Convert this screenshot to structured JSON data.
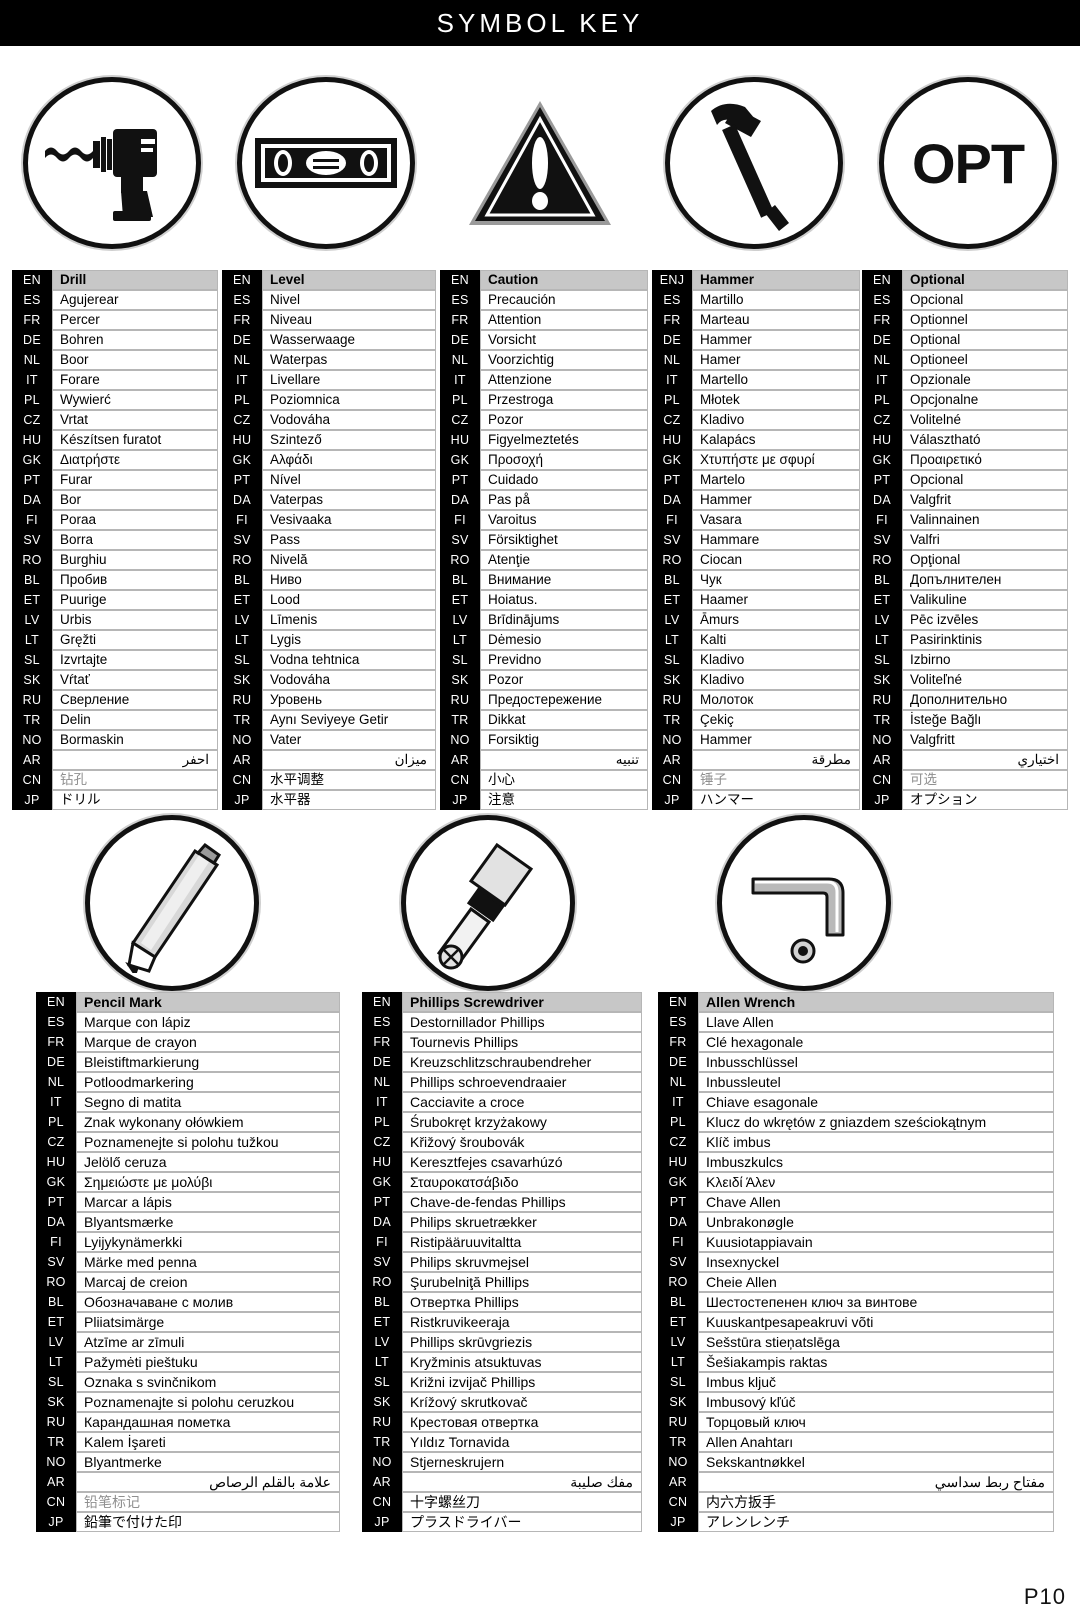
{
  "header": {
    "title": "SYMBOL KEY"
  },
  "footer": {
    "page_number": "P10"
  },
  "language_codes": [
    "EN",
    "ES",
    "FR",
    "DE",
    "NL",
    "IT",
    "PL",
    "CZ",
    "HU",
    "GK",
    "PT",
    "DA",
    "FI",
    "SV",
    "RO",
    "BL",
    "ET",
    "LV",
    "LT",
    "SL",
    "SK",
    "RU",
    "TR",
    "NO",
    "AR",
    "CN",
    "JP"
  ],
  "top_symbols": [
    {
      "icon": "drill-icon",
      "label": "Drill"
    },
    {
      "icon": "level-icon",
      "label": "Level"
    },
    {
      "icon": "caution-triangle-icon",
      "label": "Caution"
    },
    {
      "icon": "hammer-icon",
      "label": "Hammer"
    },
    {
      "icon": "opt-text-icon",
      "label": "OPT"
    }
  ],
  "bottom_symbols": [
    {
      "icon": "pencil-icon",
      "label": "Pencil Mark"
    },
    {
      "icon": "phillips-screwdriver-icon",
      "label": "Phillips Screwdriver"
    },
    {
      "icon": "allen-wrench-icon",
      "label": "Allen Wrench"
    }
  ],
  "top_tables": [
    {
      "name": "drill",
      "header_code": "EN",
      "header_value": "Drill",
      "rows": [
        {
          "code": "ES",
          "value": "Agujerear"
        },
        {
          "code": "FR",
          "value": "Percer"
        },
        {
          "code": "DE",
          "value": "Bohren"
        },
        {
          "code": "NL",
          "value": "Boor"
        },
        {
          "code": "IT",
          "value": "Forare"
        },
        {
          "code": "PL",
          "value": "Wywierć"
        },
        {
          "code": "CZ",
          "value": "Vrtat"
        },
        {
          "code": "HU",
          "value": "Készítsen furatot"
        },
        {
          "code": "GK",
          "value": "Διατρήστε"
        },
        {
          "code": "PT",
          "value": "Furar"
        },
        {
          "code": "DA",
          "value": "Bor"
        },
        {
          "code": "FI",
          "value": "Poraa"
        },
        {
          "code": "SV",
          "value": "Borra"
        },
        {
          "code": "RO",
          "value": "Burghiu"
        },
        {
          "code": "BL",
          "value": "Пробив"
        },
        {
          "code": "ET",
          "value": "Puurige"
        },
        {
          "code": "LV",
          "value": "Urbis"
        },
        {
          "code": "LT",
          "value": "Gręžti"
        },
        {
          "code": "SL",
          "value": "Izvrtajte"
        },
        {
          "code": "SK",
          "value": "Vŕtať"
        },
        {
          "code": "RU",
          "value": "Сверление"
        },
        {
          "code": "TR",
          "value": "Delin"
        },
        {
          "code": "NO",
          "value": "Bormaskin"
        },
        {
          "code": "AR",
          "value": "احفر"
        },
        {
          "code": "CN",
          "value": "钻孔"
        },
        {
          "code": "JP",
          "value": "ドリル"
        }
      ]
    },
    {
      "name": "level",
      "header_code": "EN",
      "header_value": "Level",
      "rows": [
        {
          "code": "ES",
          "value": "Nivel"
        },
        {
          "code": "FR",
          "value": "Niveau"
        },
        {
          "code": "DE",
          "value": "Wasserwaage"
        },
        {
          "code": "NL",
          "value": "Waterpas"
        },
        {
          "code": "IT",
          "value": "Livellare"
        },
        {
          "code": "PL",
          "value": "Poziomnica"
        },
        {
          "code": "CZ",
          "value": "Vodováha"
        },
        {
          "code": "HU",
          "value": "Szintező"
        },
        {
          "code": "GK",
          "value": "Αλφάδι"
        },
        {
          "code": "PT",
          "value": "Nível"
        },
        {
          "code": "DA",
          "value": "Vaterpas"
        },
        {
          "code": "FI",
          "value": "Vesivaaka"
        },
        {
          "code": "SV",
          "value": "Pass"
        },
        {
          "code": "RO",
          "value": "Nivelă"
        },
        {
          "code": "BL",
          "value": "Ниво"
        },
        {
          "code": "ET",
          "value": "Lood"
        },
        {
          "code": "LV",
          "value": "Līmenis"
        },
        {
          "code": "LT",
          "value": "Lygis"
        },
        {
          "code": "SL",
          "value": "Vodna tehtnica"
        },
        {
          "code": "SK",
          "value": "Vodováha"
        },
        {
          "code": "RU",
          "value": "Уровень"
        },
        {
          "code": "TR",
          "value": "Aynı Seviyeye Getir"
        },
        {
          "code": "NO",
          "value": "Vater"
        },
        {
          "code": "AR",
          "value": "ميزان"
        },
        {
          "code": "CN",
          "value": "水平调整"
        },
        {
          "code": "JP",
          "value": "水平器"
        }
      ]
    },
    {
      "name": "caution",
      "header_code": "EN",
      "header_value": "Caution",
      "rows": [
        {
          "code": "ES",
          "value": "Precaución"
        },
        {
          "code": "FR",
          "value": "Attention"
        },
        {
          "code": "DE",
          "value": "Vorsicht"
        },
        {
          "code": "NL",
          "value": "Voorzichtig"
        },
        {
          "code": "IT",
          "value": "Attenzione"
        },
        {
          "code": "PL",
          "value": "Przestroga"
        },
        {
          "code": "CZ",
          "value": "Pozor"
        },
        {
          "code": "HU",
          "value": "Figyelmeztetés"
        },
        {
          "code": "GK",
          "value": "Προσοχή"
        },
        {
          "code": "PT",
          "value": "Cuidado"
        },
        {
          "code": "DA",
          "value": "Pas på"
        },
        {
          "code": "FI",
          "value": "Varoitus"
        },
        {
          "code": "SV",
          "value": "Försiktighet"
        },
        {
          "code": "RO",
          "value": "Atenţie"
        },
        {
          "code": "BL",
          "value": "Внимание"
        },
        {
          "code": "ET",
          "value": "Hoiatus."
        },
        {
          "code": "LV",
          "value": "Brīdinājums"
        },
        {
          "code": "LT",
          "value": "Dėmesio"
        },
        {
          "code": "SL",
          "value": "Previdno"
        },
        {
          "code": "SK",
          "value": "Pozor"
        },
        {
          "code": "RU",
          "value": "Предостережение"
        },
        {
          "code": "TR",
          "value": "Dikkat"
        },
        {
          "code": "NO",
          "value": "Forsiktig"
        },
        {
          "code": "AR",
          "value": "تنبيه"
        },
        {
          "code": "CN",
          "value": "小心"
        },
        {
          "code": "JP",
          "value": "注意"
        }
      ]
    },
    {
      "name": "hammer",
      "header_code": "ENJ",
      "header_value": "Hammer",
      "rows": [
        {
          "code": "ES",
          "value": "Martillo"
        },
        {
          "code": "FR",
          "value": "Marteau"
        },
        {
          "code": "DE",
          "value": "Hammer"
        },
        {
          "code": "NL",
          "value": "Hamer"
        },
        {
          "code": "IT",
          "value": "Martello"
        },
        {
          "code": "PL",
          "value": "Młotek"
        },
        {
          "code": "CZ",
          "value": "Kladivo"
        },
        {
          "code": "HU",
          "value": "Kalapács"
        },
        {
          "code": "GK",
          "value": "Χτυπήστε με σφυρί"
        },
        {
          "code": "PT",
          "value": "Martelo"
        },
        {
          "code": "DA",
          "value": "Hammer"
        },
        {
          "code": "FI",
          "value": "Vasara"
        },
        {
          "code": "SV",
          "value": "Hammare"
        },
        {
          "code": "RO",
          "value": "Ciocan"
        },
        {
          "code": "BL",
          "value": "Чук"
        },
        {
          "code": "ET",
          "value": "Haamer"
        },
        {
          "code": "LV",
          "value": "Āmurs"
        },
        {
          "code": "LT",
          "value": "Kalti"
        },
        {
          "code": "SL",
          "value": "Kladivo"
        },
        {
          "code": "SK",
          "value": "Kladivo"
        },
        {
          "code": "RU",
          "value": "Молоток"
        },
        {
          "code": "TR",
          "value": "Çekiç"
        },
        {
          "code": "NO",
          "value": "Hammer"
        },
        {
          "code": "AR",
          "value": "مطرقة"
        },
        {
          "code": "CN",
          "value": "锤子"
        },
        {
          "code": "JP",
          "value": "ハンマー"
        }
      ]
    },
    {
      "name": "optional",
      "header_code": "EN",
      "header_value": "Optional",
      "rows": [
        {
          "code": "ES",
          "value": "Opcional"
        },
        {
          "code": "FR",
          "value": "Optionnel"
        },
        {
          "code": "DE",
          "value": "Optional"
        },
        {
          "code": "NL",
          "value": "Optioneel"
        },
        {
          "code": "IT",
          "value": "Opzionale"
        },
        {
          "code": "PL",
          "value": "Opcjonalne"
        },
        {
          "code": "CZ",
          "value": "Volitelné"
        },
        {
          "code": "HU",
          "value": "Választható"
        },
        {
          "code": "GK",
          "value": "Προαιρετικό"
        },
        {
          "code": "PT",
          "value": "Opcional"
        },
        {
          "code": "DA",
          "value": "Valgfrit"
        },
        {
          "code": "FI",
          "value": "Valinnainen"
        },
        {
          "code": "SV",
          "value": "Valfri"
        },
        {
          "code": "RO",
          "value": "Opţional"
        },
        {
          "code": "BL",
          "value": "Допълнителен"
        },
        {
          "code": "ET",
          "value": "Valikuline"
        },
        {
          "code": "LV",
          "value": "Pēc izvēles"
        },
        {
          "code": "LT",
          "value": "Pasirinktinis"
        },
        {
          "code": "SL",
          "value": "Izbirno"
        },
        {
          "code": "SK",
          "value": "Voliteľné"
        },
        {
          "code": "RU",
          "value": "Дополнительно"
        },
        {
          "code": "TR",
          "value": "İsteğe Bağlı"
        },
        {
          "code": "NO",
          "value": "Valgfritt"
        },
        {
          "code": "AR",
          "value": "اختياري"
        },
        {
          "code": "CN",
          "value": "可选"
        },
        {
          "code": "JP",
          "value": "オプション"
        }
      ]
    }
  ],
  "bottom_tables": [
    {
      "name": "pencil-mark",
      "header_code": "EN",
      "header_value": "Pencil Mark",
      "rows": [
        {
          "code": "ES",
          "value": "Marque con lápiz"
        },
        {
          "code": "FR",
          "value": "Marque de crayon"
        },
        {
          "code": "DE",
          "value": "Bleistiftmarkierung"
        },
        {
          "code": "NL",
          "value": "Potloodmarkering"
        },
        {
          "code": "IT",
          "value": "Segno di matita"
        },
        {
          "code": "PL",
          "value": "Znak wykonany ołówkiem"
        },
        {
          "code": "CZ",
          "value": "Poznamenejte si polohu tužkou"
        },
        {
          "code": "HU",
          "value": "Jelölő ceruza"
        },
        {
          "code": "GK",
          "value": "Σημειώστε με μολύβι"
        },
        {
          "code": "PT",
          "value": "Marcar a lápis"
        },
        {
          "code": "DA",
          "value": "Blyantsmærke"
        },
        {
          "code": "FI",
          "value": "Lyijykynämerkki"
        },
        {
          "code": "SV",
          "value": "Märke med penna"
        },
        {
          "code": "RO",
          "value": "Marcaj de creion"
        },
        {
          "code": "BL",
          "value": "Обозначаване с молив"
        },
        {
          "code": "ET",
          "value": "Pliiatsimärge"
        },
        {
          "code": "LV",
          "value": "Atzīme ar zīmuli"
        },
        {
          "code": "LT",
          "value": "Pažymėti pieštuku"
        },
        {
          "code": "SL",
          "value": "Oznaka s svinčnikom"
        },
        {
          "code": "SK",
          "value": "Poznamenajte si polohu ceruzkou"
        },
        {
          "code": "RU",
          "value": "Карандашная пометка"
        },
        {
          "code": "TR",
          "value": "Kalem İşareti"
        },
        {
          "code": "NO",
          "value": "Blyantmerke"
        },
        {
          "code": "AR",
          "value": "علامة بالقلم الرصاص"
        },
        {
          "code": "CN",
          "value": "铅笔标记"
        },
        {
          "code": "JP",
          "value": "鉛筆で付けた印"
        }
      ]
    },
    {
      "name": "phillips-screwdriver",
      "header_code": "EN",
      "header_value": "Phillips Screwdriver",
      "rows": [
        {
          "code": "ES",
          "value": "Destornillador Phillips"
        },
        {
          "code": "FR",
          "value": "Tournevis Phillips"
        },
        {
          "code": "DE",
          "value": "Kreuzschlitzschraubendreher"
        },
        {
          "code": "NL",
          "value": "Phillips schroevendraaier"
        },
        {
          "code": "IT",
          "value": "Cacciavite a croce"
        },
        {
          "code": "PL",
          "value": "Śrubokręt krzyżakowy"
        },
        {
          "code": "CZ",
          "value": "Křižový šroubovák"
        },
        {
          "code": "HU",
          "value": "Keresztfejes csavarhúzó"
        },
        {
          "code": "GK",
          "value": "Σταυροκατσάβιδο"
        },
        {
          "code": "PT",
          "value": "Chave-de-fendas Phillips"
        },
        {
          "code": "DA",
          "value": "Philips skruetrækker"
        },
        {
          "code": "FI",
          "value": "Ristipääruuvitaltta"
        },
        {
          "code": "SV",
          "value": "Philips skruvmejsel"
        },
        {
          "code": "RO",
          "value": "Şurubelniţă Phillips"
        },
        {
          "code": "BL",
          "value": "Отвертка Phillips"
        },
        {
          "code": "ET",
          "value": "Ristkruvikeeraja"
        },
        {
          "code": "LV",
          "value": "Phillips skrūvgriezis"
        },
        {
          "code": "LT",
          "value": "Kryžminis atsuktuvas"
        },
        {
          "code": "SL",
          "value": "Križni izvijač Phillips"
        },
        {
          "code": "SK",
          "value": "Krížový skrutkovač"
        },
        {
          "code": "RU",
          "value": "Крестовая отвертка"
        },
        {
          "code": "TR",
          "value": "Yıldız Tornavida"
        },
        {
          "code": "NO",
          "value": "Stjerneskrujern"
        },
        {
          "code": "AR",
          "value": "مفك صليبة"
        },
        {
          "code": "CN",
          "value": "十字螺丝刀"
        },
        {
          "code": "JP",
          "value": "プラスドライバー"
        }
      ]
    },
    {
      "name": "allen-wrench",
      "header_code": "EN",
      "header_value": "Allen Wrench",
      "rows": [
        {
          "code": "ES",
          "value": "Llave Allen"
        },
        {
          "code": "FR",
          "value": "Clé hexagonale"
        },
        {
          "code": "DE",
          "value": "Inbusschlüssel"
        },
        {
          "code": "NL",
          "value": "Inbussleutel"
        },
        {
          "code": "IT",
          "value": "Chiave esagonale"
        },
        {
          "code": "PL",
          "value": "Klucz do wkrętów z gniazdem sześciokątnym"
        },
        {
          "code": "CZ",
          "value": "Klíč imbus"
        },
        {
          "code": "HU",
          "value": "Imbuszkulcs"
        },
        {
          "code": "GK",
          "value": "Κλειδί Άλεν"
        },
        {
          "code": "PT",
          "value": "Chave Allen"
        },
        {
          "code": "DA",
          "value": "Unbrakonøgle"
        },
        {
          "code": "FI",
          "value": "Kuusiotappiavain"
        },
        {
          "code": "SV",
          "value": "Insexnyckel"
        },
        {
          "code": "RO",
          "value": "Cheie Allen"
        },
        {
          "code": "BL",
          "value": "Шестостепенен ключ за винтове"
        },
        {
          "code": "ET",
          "value": "Kuuskantpesapeakruvi võti"
        },
        {
          "code": "LV",
          "value": "Sešstūra stieņatslēga"
        },
        {
          "code": "LT",
          "value": "Šešiakampis raktas"
        },
        {
          "code": "SL",
          "value": "Imbus ključ"
        },
        {
          "code": "SK",
          "value": "Imbusový kľúč"
        },
        {
          "code": "RU",
          "value": "Торцовый ключ"
        },
        {
          "code": "TR",
          "value": "Allen Anahtarı"
        },
        {
          "code": "NO",
          "value": "Sekskantnøkkel"
        },
        {
          "code": "AR",
          "value": "مفتاح ربط سداسي"
        },
        {
          "code": "CN",
          "value": "内六方扳手"
        },
        {
          "code": "JP",
          "value": "アレンレンチ"
        }
      ]
    }
  ]
}
